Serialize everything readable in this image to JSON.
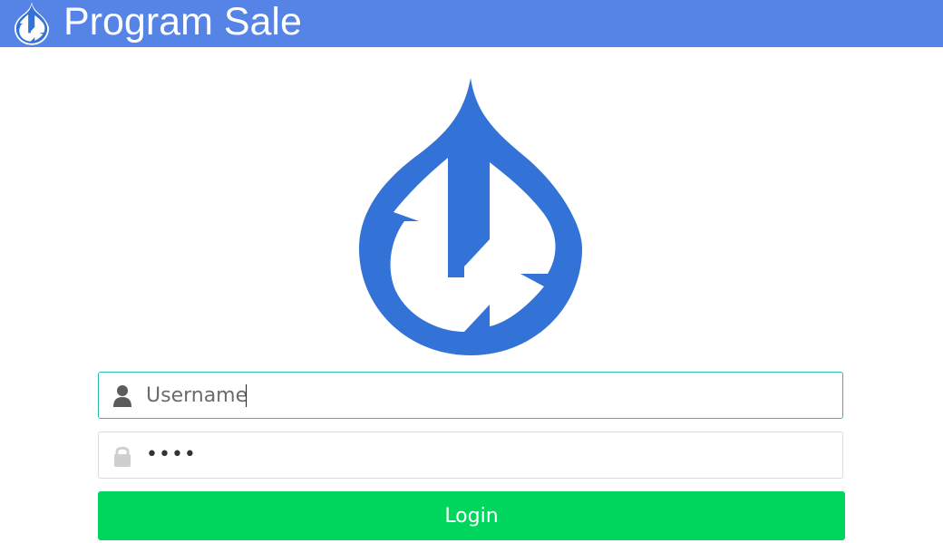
{
  "header": {
    "title": "Program Sale",
    "logo_icon": "drop-logo-icon",
    "background_color": "#5583e6"
  },
  "main_logo": {
    "icon": "drop-logo-icon",
    "color": "#3372d6"
  },
  "login_form": {
    "username": {
      "icon": "user-icon",
      "placeholder": "Username",
      "value": ""
    },
    "password": {
      "icon": "lock-icon",
      "value": "••••"
    },
    "submit_label": "Login",
    "submit_color": "#00d65d"
  }
}
